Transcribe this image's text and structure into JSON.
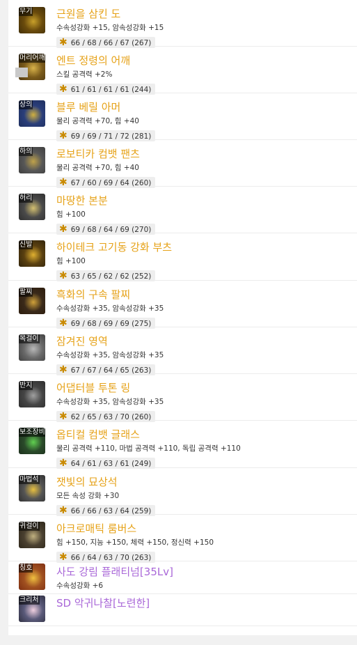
{
  "colors": {
    "title_default": "#e6a218",
    "title_special": "#a967d8",
    "star": "#c98a00"
  },
  "items": [
    {
      "slot": "무기",
      "name": "근원을 삼킨 도",
      "options": "수속성강화 +15, 암속성강화 +15",
      "stars": "66 / 68 / 66 / 67 (267)",
      "color": "#e6a218",
      "icon": "weapon-icon"
    },
    {
      "slot": "머리어깨",
      "name": "엔트 정령의 어깨",
      "options": "스킬 공격력 +2%",
      "stars": "61 / 61 / 61 / 61 (244)",
      "color": "#e6a218",
      "icon": "shoulder-icon"
    },
    {
      "slot": "상의",
      "name": "블루 베릴 아머",
      "options": "물리 공격력 +70, 힘 +40",
      "stars": "69 / 69 / 71 / 72 (281)",
      "color": "#e6a218",
      "icon": "armor-icon"
    },
    {
      "slot": "하의",
      "name": "로보티카 컴뱃 팬츠",
      "options": "물리 공격력 +70, 힘 +40",
      "stars": "67 / 60 / 69 / 64 (260)",
      "color": "#e6a218",
      "icon": "pants-icon"
    },
    {
      "slot": "허리",
      "name": "마땅한 본분",
      "options": "힘 +100",
      "stars": "69 / 68 / 64 / 69 (270)",
      "color": "#e6a218",
      "icon": "belt-icon"
    },
    {
      "slot": "신발",
      "name": "하이테크 고기동 강화 부츠",
      "options": "힘 +100",
      "stars": "63 / 65 / 62 / 62 (252)",
      "color": "#e6a218",
      "icon": "boots-icon"
    },
    {
      "slot": "팔찌",
      "name": "흑화의 구속 팔찌",
      "options": "수속성강화 +35, 암속성강화 +35",
      "stars": "69 / 68 / 69 / 69 (275)",
      "color": "#e6a218",
      "icon": "bracelet-icon"
    },
    {
      "slot": "목걸이",
      "name": "잠겨진 영역",
      "options": "수속성강화 +35, 암속성강화 +35",
      "stars": "67 / 67 / 64 / 65 (263)",
      "color": "#e6a218",
      "icon": "necklace-icon"
    },
    {
      "slot": "반지",
      "name": "어댑터블 투톤 링",
      "options": "수속성강화 +35, 암속성강화 +35",
      "stars": "62 / 65 / 63 / 70 (260)",
      "color": "#e6a218",
      "icon": "ring-icon"
    },
    {
      "slot": "보조장비",
      "name": "옵티컬 컴뱃 글래스",
      "options": "물리 공격력 +110, 마법 공격력 +110, 독립 공격력 +110",
      "stars": "64 / 61 / 63 / 61 (249)",
      "color": "#e6a218",
      "icon": "glasses-icon"
    },
    {
      "slot": "마법석",
      "name": "잿빛의 묘상석",
      "options": "모든 속성 강화 +30",
      "stars": "66 / 66 / 63 / 64 (259)",
      "color": "#e6a218",
      "icon": "magicstone-icon"
    },
    {
      "slot": "귀걸이",
      "name": "아크로매틱 룸버스",
      "options": "힘 +150, 지능 +150, 체력 +150, 정신력 +150",
      "stars": "66 / 64 / 63 / 70 (263)",
      "color": "#e6a218",
      "icon": "earring-icon"
    },
    {
      "slot": "칭호",
      "name": "사도 강림 플래티넘[35Lv]",
      "options": "수속성강화 +6",
      "stars": null,
      "color": "#a967d8",
      "icon": "title-icon"
    },
    {
      "slot": "크리처",
      "name": "SD 악귀나찰[노련한]",
      "options": null,
      "stars": null,
      "color": "#a967d8",
      "icon": "creature-icon"
    }
  ]
}
